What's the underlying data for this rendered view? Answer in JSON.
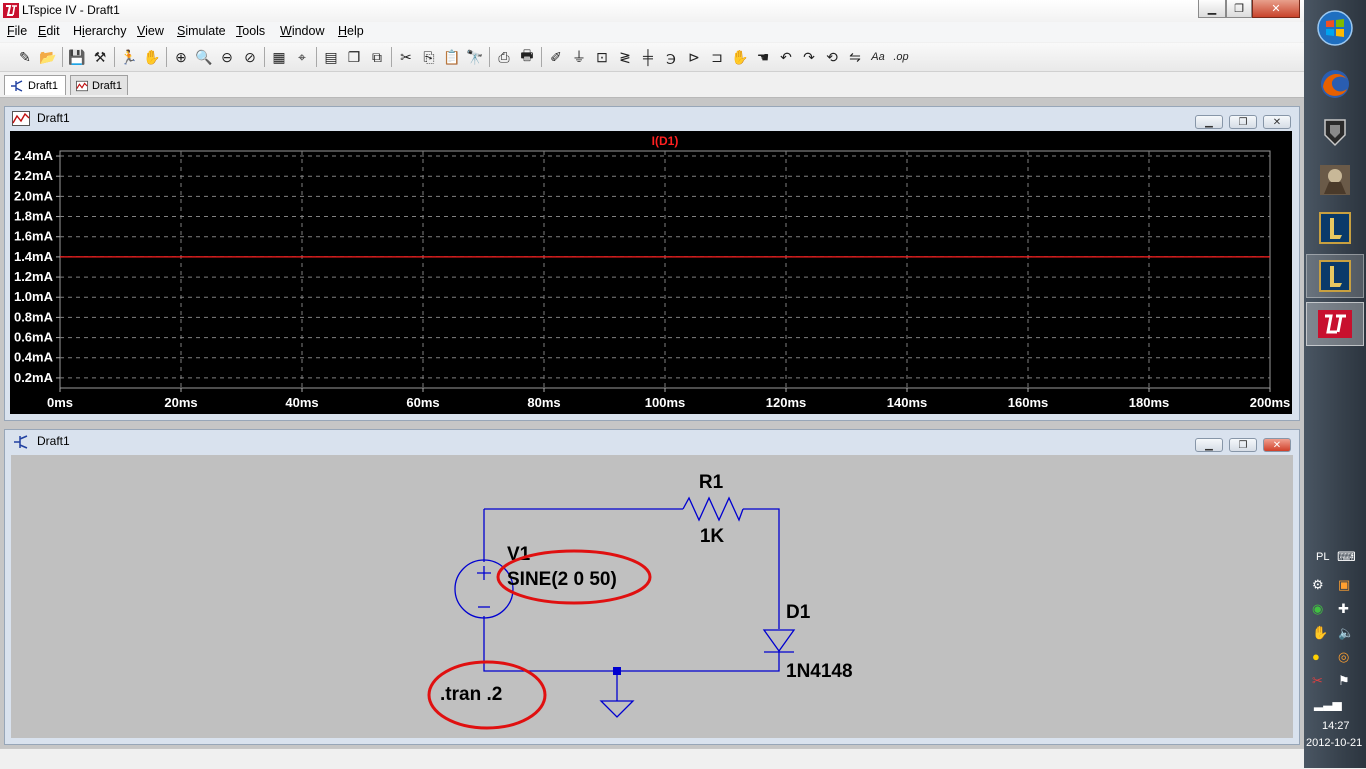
{
  "window": {
    "title": "LTspice IV - Draft1",
    "minimize_glyph": "▁",
    "maximize_glyph": "❐",
    "close_glyph": "✕"
  },
  "menu": [
    "File",
    "Edit",
    "Hierarchy",
    "View",
    "Simulate",
    "Tools",
    "Window",
    "Help"
  ],
  "menu_hotkeys": [
    "F",
    "E",
    "i",
    "V",
    "S",
    "T",
    "W",
    "H"
  ],
  "toolbar": {
    "icons": [
      "new-schematic-icon",
      "open-icon",
      "save-icon",
      "control-panel-icon",
      "run-icon",
      "halt-icon",
      "zoom-in-icon",
      "zoom-pan-icon",
      "zoom-out-icon",
      "zoom-fit-icon",
      "autorange-icon",
      "mark-cursor-icon",
      "tile-icon",
      "cascade-icon",
      "close-windows-icon",
      "cut-icon",
      "copy-icon",
      "paste-icon",
      "find-icon",
      "print-setup-icon",
      "print-icon",
      "draw-wire-icon",
      "ground-icon",
      "label-net-icon",
      "resistor-icon",
      "capacitor-icon",
      "inductor-icon",
      "diode-icon",
      "component-icon",
      "move-icon",
      "drag-icon",
      "undo-icon",
      "redo-icon",
      "rotate-icon",
      "mirror-icon",
      "text-icon",
      "spice-directive-icon"
    ],
    "glyphs": {
      "text": "Aa",
      "spice": ".op"
    }
  },
  "tabs": [
    {
      "label": "Draft1",
      "kind": "schematic",
      "active": true
    },
    {
      "label": "Draft1",
      "kind": "waveform",
      "active": false
    }
  ],
  "waveform_window": {
    "title": "Draft1",
    "trace_label": "I(D1)",
    "trace_color": "#ff2020",
    "background": "#000000"
  },
  "chart_data": {
    "type": "line",
    "title": "I(D1)",
    "xlabel": "",
    "ylabel": "",
    "x_tick_labels": [
      "0ms",
      "20ms",
      "40ms",
      "60ms",
      "80ms",
      "100ms",
      "120ms",
      "140ms",
      "160ms",
      "180ms",
      "200ms"
    ],
    "x_ticks": [
      0,
      20,
      40,
      60,
      80,
      100,
      120,
      140,
      160,
      180,
      200
    ],
    "y_tick_labels": [
      "0.2mA",
      "0.4mA",
      "0.6mA",
      "0.8mA",
      "1.0mA",
      "1.2mA",
      "1.4mA",
      "1.6mA",
      "1.8mA",
      "2.0mA",
      "2.2mA",
      "2.4mA"
    ],
    "y_ticks": [
      0.2,
      0.4,
      0.6,
      0.8,
      1.0,
      1.2,
      1.4,
      1.6,
      1.8,
      2.0,
      2.2,
      2.4
    ],
    "xlim": [
      0,
      200
    ],
    "ylim": [
      0.1,
      2.45
    ],
    "grid": true,
    "series": [
      {
        "name": "I(D1)",
        "x": [
          0,
          200
        ],
        "values": [
          1.4,
          1.4
        ],
        "color": "#ff2020"
      }
    ]
  },
  "schematic_window": {
    "title": "Draft1",
    "background": "#c0c0c0",
    "wire_color": "#0000d0",
    "highlight_color": "#e01010",
    "components": {
      "resistor": {
        "ref": "R1",
        "value": "1K"
      },
      "source": {
        "ref": "V1",
        "value": "SINE(2 0 50)"
      },
      "diode": {
        "ref": "D1",
        "value": "1N4148"
      }
    },
    "directive": ".tran .2"
  },
  "taskbar": {
    "buttons": [
      "start-orb-icon",
      "firefox-icon",
      "world-of-tanks-icon",
      "game-character-icon",
      "league-of-legends-icon",
      "league-of-legends-icon",
      "ltspice-icon"
    ],
    "language": "PL",
    "time": "14:27",
    "date": "2012-10-21"
  }
}
